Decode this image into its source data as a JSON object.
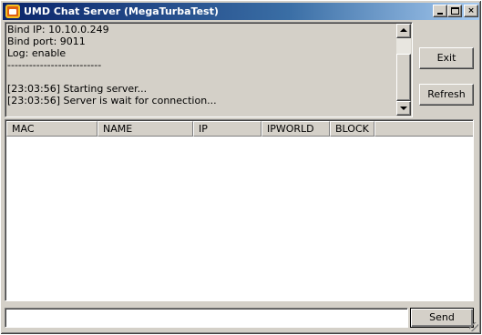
{
  "window": {
    "title": "UMD Chat Server (MegaTurbaTest)",
    "icon": "chat-server-app-icon",
    "controls": {
      "minimize": "minimize-icon",
      "maximize": "maximize-icon",
      "close": "×"
    }
  },
  "log": {
    "lines": [
      "Bind IP: 10.10.0.249",
      "Bind port: 9011",
      "Log: enable",
      "--------------------------",
      "",
      "[23:03:56] Starting server...",
      "[23:03:56] Server is wait for connection..."
    ]
  },
  "buttons": {
    "exit": "Exit",
    "refresh": "Refresh",
    "send": "Send"
  },
  "clients_table": {
    "columns": [
      "MAC",
      "NAME",
      "IP",
      "IPWORLD",
      "BLOCK",
      ""
    ],
    "rows": []
  },
  "message_input": {
    "value": "",
    "placeholder": ""
  },
  "colors": {
    "titlebar_start": "#0a246a",
    "titlebar_end": "#a6caf0",
    "face": "#d4d0c8"
  }
}
